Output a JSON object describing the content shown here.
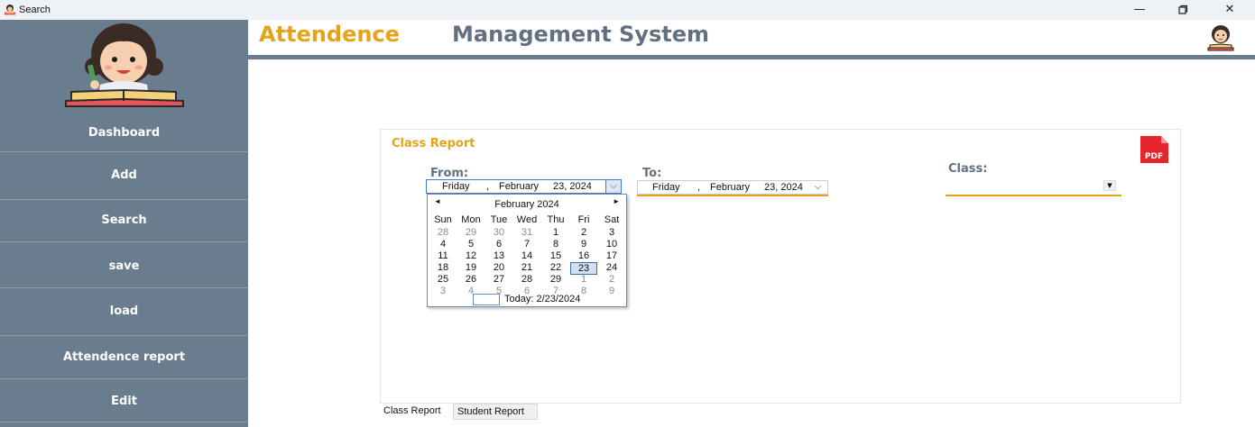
{
  "window": {
    "title": "Search"
  },
  "header": {
    "title_part1": "Attendence",
    "title_part2": "Management System"
  },
  "sidebar": {
    "items": [
      {
        "label": "Dashboard"
      },
      {
        "label": "Add"
      },
      {
        "label": "Search"
      },
      {
        "label": "save"
      },
      {
        "label": "load"
      },
      {
        "label": "Attendence report"
      },
      {
        "label": "Edit"
      }
    ]
  },
  "report": {
    "title": "Class Report",
    "pdf_label": "PDF",
    "from_label": "From:",
    "from_date": {
      "weekday": "Friday",
      "sep": ",",
      "month": "February",
      "day_year": "23, 2024"
    },
    "to_label": "To:",
    "to_date": {
      "weekday": "Friday",
      "sep": ",",
      "month": "February",
      "day_year": "23, 2024"
    },
    "class_label": "Class:",
    "class_value": ""
  },
  "calendar": {
    "month_label": "February 2024",
    "weekdays": [
      "Sun",
      "Mon",
      "Tue",
      "Wed",
      "Thu",
      "Fri",
      "Sat"
    ],
    "weeks": [
      [
        "28",
        "29",
        "30",
        "31",
        "1",
        "2",
        "3"
      ],
      [
        "4",
        "5",
        "6",
        "7",
        "8",
        "9",
        "10"
      ],
      [
        "11",
        "12",
        "13",
        "14",
        "15",
        "16",
        "17"
      ],
      [
        "18",
        "19",
        "20",
        "21",
        "22",
        "23",
        "24"
      ],
      [
        "25",
        "26",
        "27",
        "28",
        "29",
        "1",
        "2"
      ],
      [
        "3",
        "4",
        "5",
        "6",
        "7",
        "8",
        "9"
      ]
    ],
    "selected": "23",
    "today_label": "Today: 2/23/2024"
  },
  "tabs": [
    {
      "label": "Class Report"
    },
    {
      "label": "Student Report"
    }
  ],
  "colors": {
    "sidebar": "#6a7d8e",
    "accent": "#e4a319",
    "heading_gray": "#627180",
    "pdf_red": "#e5262c"
  }
}
